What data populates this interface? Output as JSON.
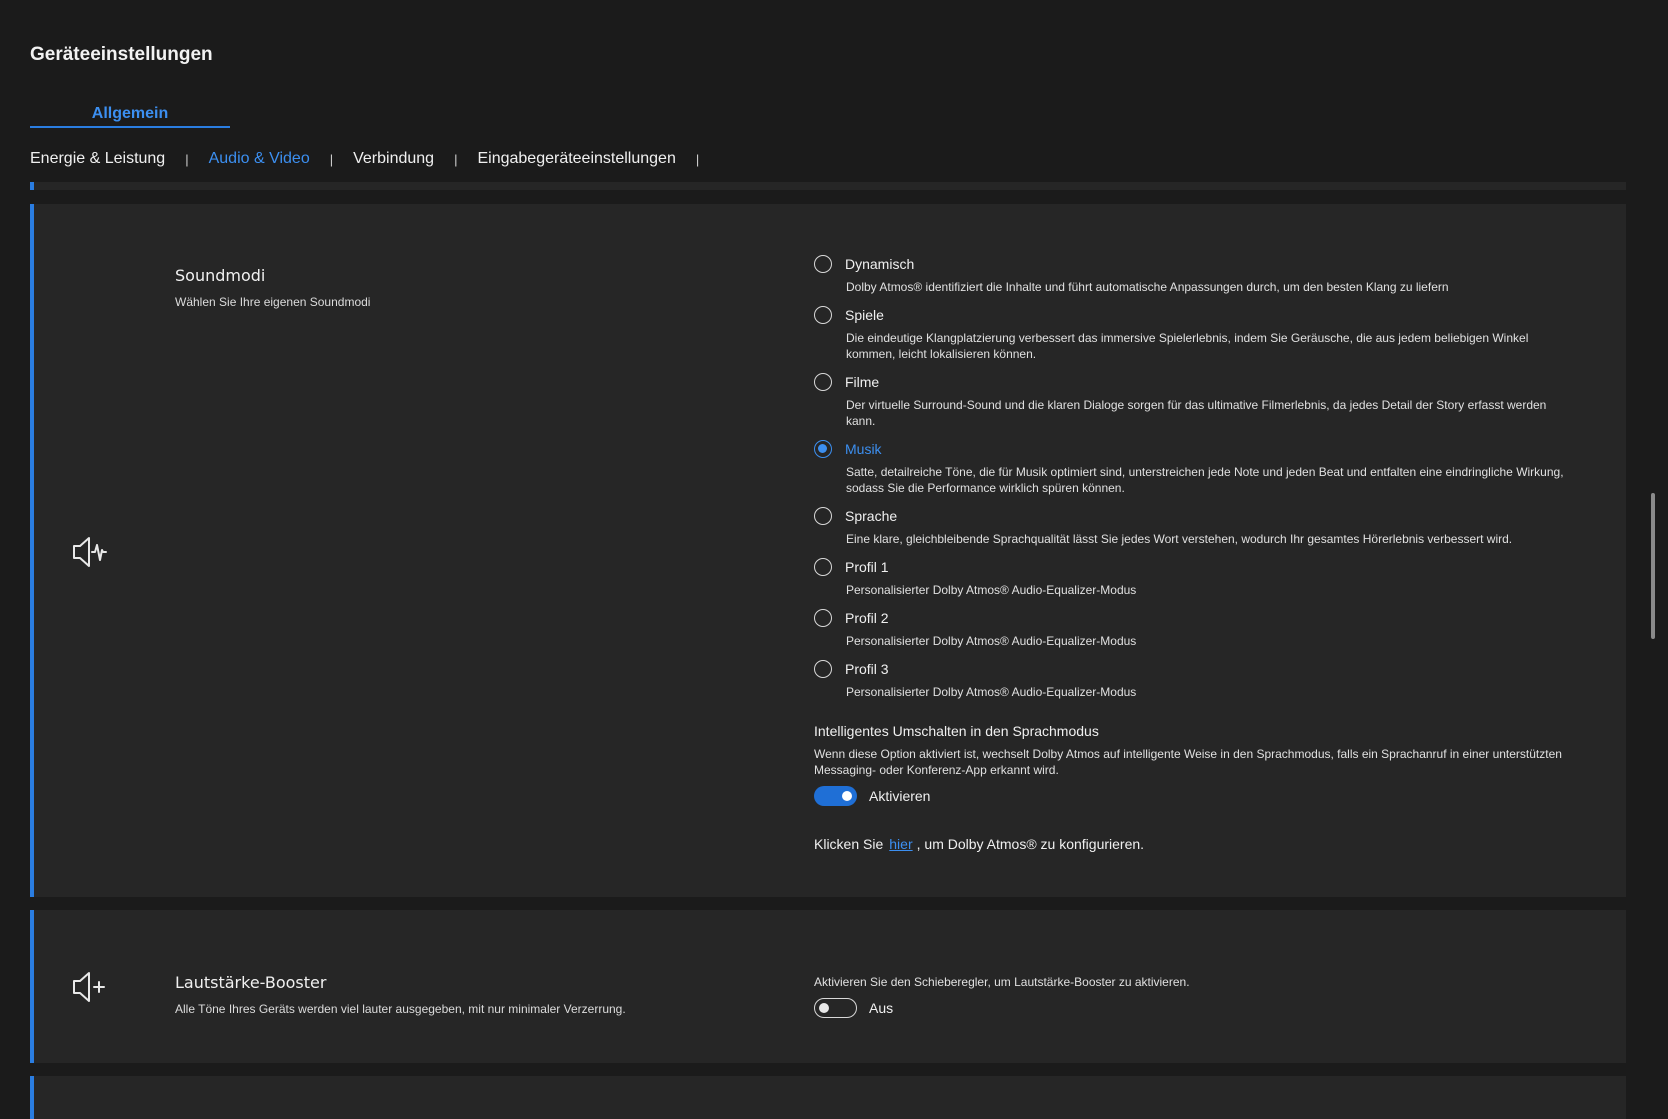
{
  "page_title": "Geräteeinstellungen",
  "main_tab": "Allgemein",
  "subtabs": [
    {
      "label": "Energie & Leistung",
      "active": false
    },
    {
      "label": "Audio & Video",
      "active": true
    },
    {
      "label": "Verbindung",
      "active": false
    },
    {
      "label": "Eingabegeräteeinstellungen",
      "active": false
    }
  ],
  "sound_modes": {
    "icon": "speaker-wave-icon",
    "title": "Soundmodi",
    "subtitle": "Wählen Sie Ihre eigenen Soundmodi",
    "selected": "Musik",
    "options": [
      {
        "label": "Dynamisch",
        "desc": "Dolby Atmos® identifiziert die Inhalte und führt automatische Anpassungen durch, um den besten Klang zu liefern"
      },
      {
        "label": "Spiele",
        "desc": "Die eindeutige Klangplatzierung verbessert das immersive Spielerlebnis, indem Sie Geräusche, die aus jedem beliebigen Winkel kommen, leicht lokalisieren können."
      },
      {
        "label": "Filme",
        "desc": "Der virtuelle Surround-Sound und die klaren Dialoge sorgen für das ultimative Filmerlebnis, da jedes Detail der Story erfasst werden kann."
      },
      {
        "label": "Musik",
        "desc": "Satte, detailreiche Töne, die für Musik optimiert sind, unterstreichen jede Note und jeden Beat und entfalten eine eindringliche Wirkung, sodass Sie die Performance wirklich spüren können."
      },
      {
        "label": "Sprache",
        "desc": "Eine klare, gleichbleibende Sprachqualität lässt Sie jedes Wort verstehen, wodurch Ihr gesamtes Hörerlebnis verbessert wird."
      },
      {
        "label": "Profil 1",
        "desc": "Personalisierter Dolby Atmos® Audio-Equalizer-Modus"
      },
      {
        "label": "Profil 2",
        "desc": "Personalisierter Dolby Atmos® Audio-Equalizer-Modus"
      },
      {
        "label": "Profil 3",
        "desc": "Personalisierter Dolby Atmos® Audio-Equalizer-Modus"
      }
    ],
    "smart_switch": {
      "title": "Intelligentes Umschalten in den Sprachmodus",
      "desc": "Wenn diese Option aktiviert ist, wechselt Dolby Atmos auf intelligente Weise in den Sprachmodus, falls ein Sprachanruf in einer unterstützten Messaging- oder Konferenz-App erkannt wird.",
      "toggle_on": true,
      "toggle_label": "Aktivieren"
    },
    "configure": {
      "prefix": "Klicken Sie",
      "link": "hier",
      "suffix": ", um Dolby Atmos® zu konfigurieren."
    }
  },
  "volume_booster": {
    "icon": "speaker-plus-icon",
    "title": "Lautstärke-Booster",
    "subtitle": "Alle Töne Ihres Geräts werden viel lauter ausgegeben, mit nur minimaler Verzerrung.",
    "hint": "Aktivieren Sie den Schieberegler, um Lautstärke-Booster zu aktivieren.",
    "toggle_on": false,
    "toggle_label": "Aus"
  },
  "colors": {
    "accent": "#2a7de1",
    "background": "#1b1b1b",
    "card": "#262626"
  }
}
